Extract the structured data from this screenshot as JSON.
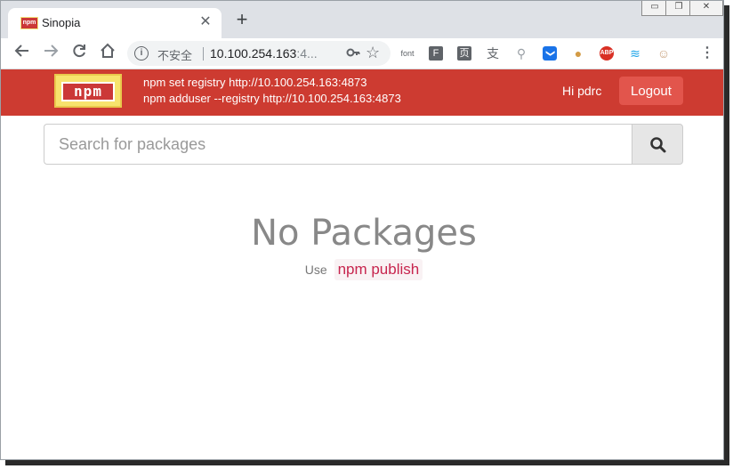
{
  "browser": {
    "tab_title": "Sinopia",
    "tab_favicon_text": "npm",
    "tab_close": "✕",
    "new_tab": "+",
    "window_controls": [
      "▭",
      "❐",
      "✕"
    ],
    "security_label": "不安全",
    "url_main": "10.100.254.163",
    "url_dim": ":4...",
    "extensions": [
      {
        "name": "font-extension-icon",
        "text": "font",
        "color": "#5f6368"
      },
      {
        "name": "f-extension-icon",
        "text": "F",
        "color": "#5f6368"
      },
      {
        "name": "page-extension-icon",
        "text": "页",
        "color": "#5f6368"
      },
      {
        "name": "shield-extension-icon",
        "text": "支",
        "color": "#5f6368"
      },
      {
        "name": "sitemap-extension-icon",
        "text": "⚲",
        "color": "#9aa0a6"
      },
      {
        "name": "pocket-extension-icon",
        "text": "❯",
        "color": "#1a73e8"
      },
      {
        "name": "cookie-extension-icon",
        "text": "●",
        "color": "#d39b45"
      },
      {
        "name": "adblock-extension-icon",
        "text": "ABP",
        "color": "#d93025"
      },
      {
        "name": "wifi-extension-icon",
        "text": "≋",
        "color": "#1aa3e8"
      },
      {
        "name": "avatar-extension-icon",
        "text": "☺",
        "color": "#c9a27e"
      }
    ]
  },
  "header": {
    "logo_text": "npm",
    "setup_lines": [
      "npm set registry http://10.100.254.163:4873",
      "npm adduser --registry http://10.100.254.163:4873"
    ],
    "greeting": "Hi pdrc",
    "logout_label": "Logout",
    "accent_color": "#cd3b31"
  },
  "search": {
    "placeholder": "Search for packages",
    "button_icon": "search-icon"
  },
  "empty_state": {
    "title": "No Packages",
    "hint_prefix": "Use",
    "hint_command": "npm publish"
  }
}
